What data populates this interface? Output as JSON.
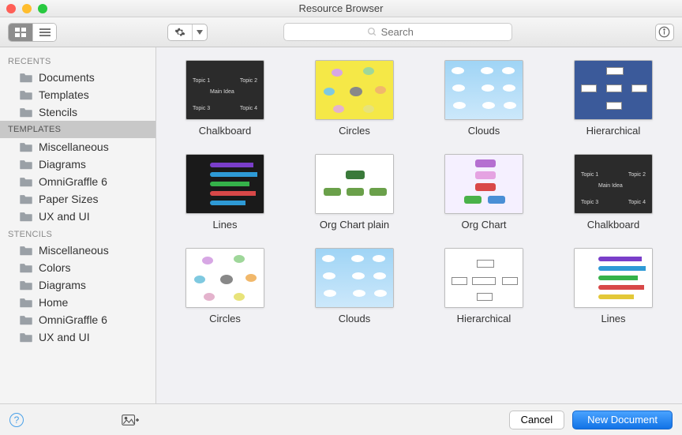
{
  "window": {
    "title": "Resource Browser"
  },
  "toolbar": {
    "search_placeholder": "Search"
  },
  "sidebar": {
    "sections": [
      {
        "header": "RECENTS",
        "items": [
          "Documents",
          "Templates",
          "Stencils"
        ]
      },
      {
        "header": "TEMPLATES",
        "selected": true,
        "items": [
          "Miscellaneous",
          "Diagrams",
          "OmniGraffle 6",
          "Paper Sizes",
          "UX and UI"
        ]
      },
      {
        "header": "STENCILS",
        "items": [
          "Miscellaneous",
          "Colors",
          "Diagrams",
          "Home",
          "OmniGraffle 6",
          "UX and UI"
        ]
      }
    ]
  },
  "templates": [
    {
      "label": "Chalkboard",
      "kind": "chalkboard"
    },
    {
      "label": "Circles",
      "kind": "circles-yellow"
    },
    {
      "label": "Clouds",
      "kind": "clouds"
    },
    {
      "label": "Hierarchical",
      "kind": "hier-blue"
    },
    {
      "label": "Lines",
      "kind": "lines-dark"
    },
    {
      "label": "Org Chart plain",
      "kind": "org-plain"
    },
    {
      "label": "Org Chart",
      "kind": "org-color"
    },
    {
      "label": "Chalkboard",
      "kind": "chalkboard"
    },
    {
      "label": "Circles",
      "kind": "circles-white"
    },
    {
      "label": "Clouds",
      "kind": "clouds"
    },
    {
      "label": "Hierarchical",
      "kind": "hier-white"
    },
    {
      "label": "Lines",
      "kind": "lines-white"
    }
  ],
  "footer": {
    "cancel": "Cancel",
    "new_document": "New Document"
  }
}
